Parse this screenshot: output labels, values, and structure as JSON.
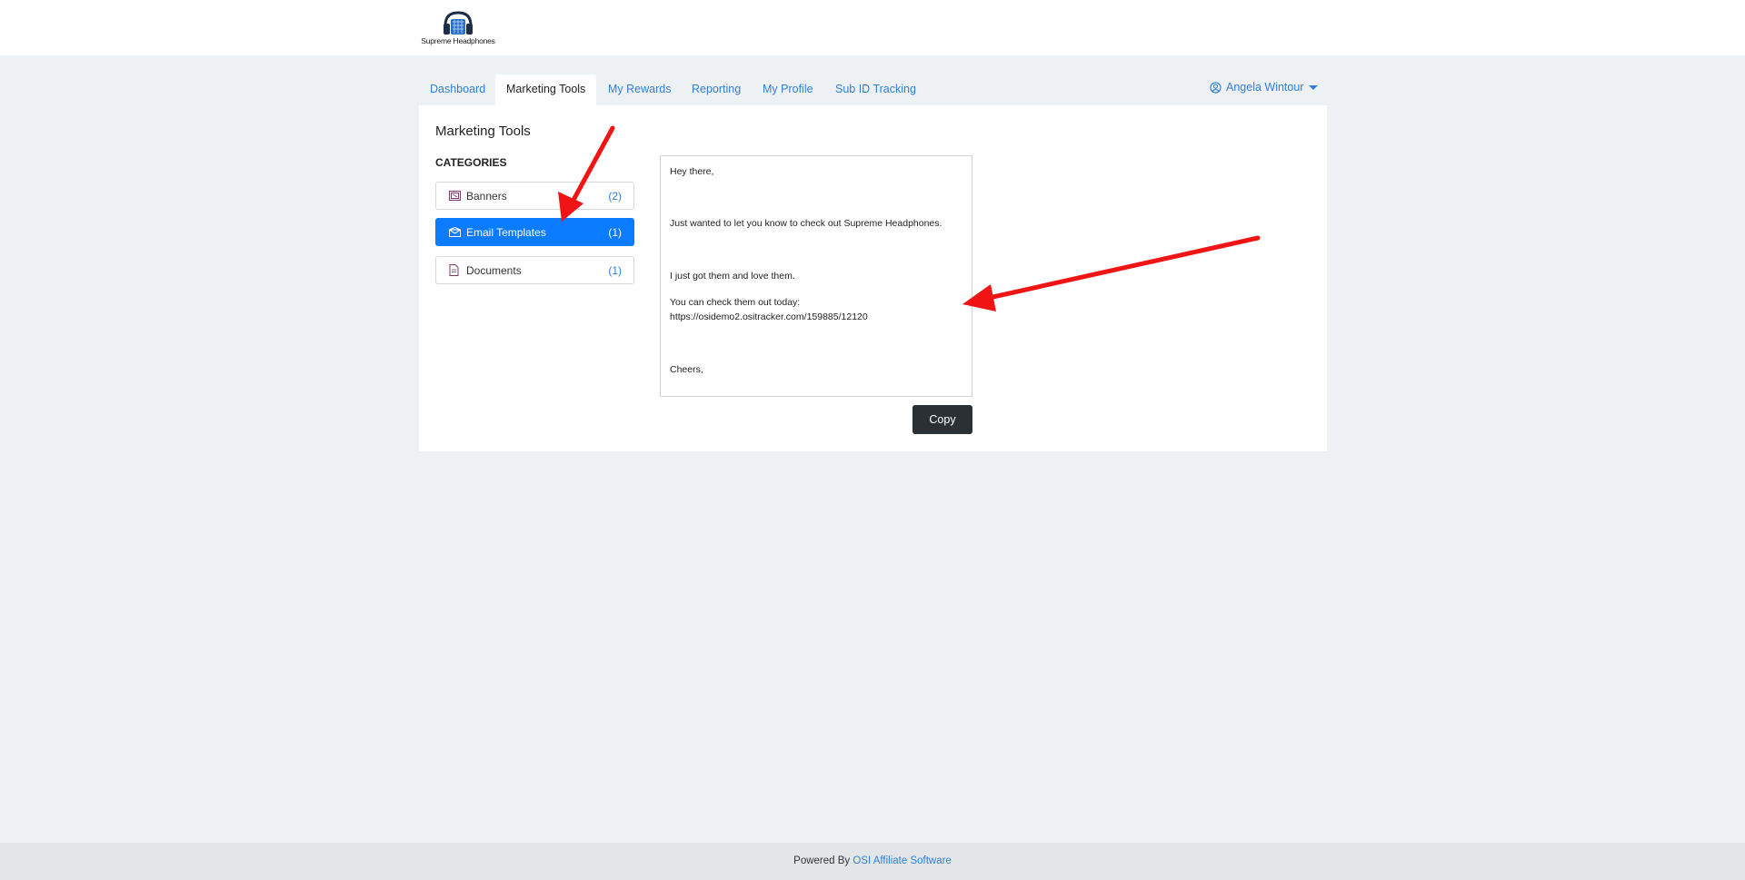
{
  "brand": {
    "name": "Supreme Headphones"
  },
  "nav": {
    "tabs": [
      {
        "label": "Dashboard"
      },
      {
        "label": "Marketing Tools"
      },
      {
        "label": "My Rewards"
      },
      {
        "label": "Reporting"
      },
      {
        "label": "My Profile"
      },
      {
        "label": "Sub ID Tracking"
      }
    ],
    "active_tab": "Marketing Tools",
    "user_name": "Angela Wintour"
  },
  "main": {
    "title": "Marketing Tools",
    "categories_heading": "CATEGORIES",
    "categories": [
      {
        "label": "Banners",
        "count": "(2)",
        "icon": "banner-icon"
      },
      {
        "label": "Email Templates",
        "count": "(1)",
        "icon": "envelope-icon"
      },
      {
        "label": "Documents",
        "count": "(1)",
        "icon": "document-icon"
      }
    ],
    "active_category": "Email Templates",
    "template_lines": [
      "Hey there,",
      "Just wanted to let you know to check out Supreme Headphones.",
      "I just got them and love them.",
      "You can check them out today:",
      "https://osidemo2.ositracker.com/159885/12120",
      "Cheers,"
    ],
    "copy_label": "Copy"
  },
  "footer": {
    "prefix": "Powered By",
    "link": "OSI Affiliate Software"
  },
  "colors": {
    "accent": "#0b7bff",
    "link": "#2f7fd8",
    "background": "#eef1f4",
    "annotation_arrow": "#f01414"
  }
}
